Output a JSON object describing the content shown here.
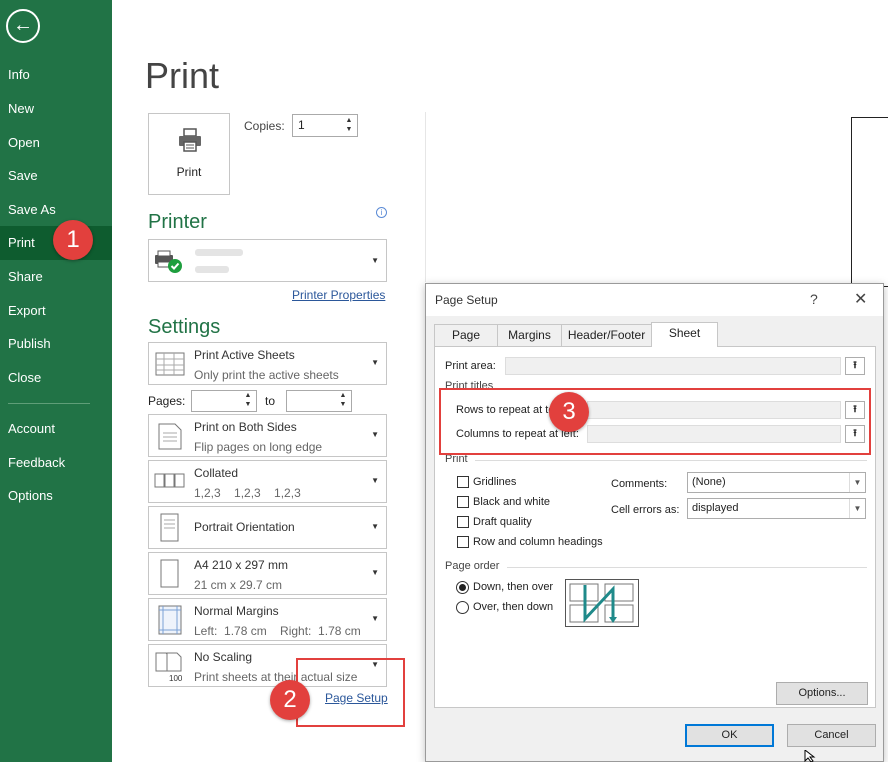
{
  "sidebar": {
    "back": "←",
    "items": [
      {
        "label": "Info"
      },
      {
        "label": "New"
      },
      {
        "label": "Open"
      },
      {
        "label": "Save"
      },
      {
        "label": "Save As"
      },
      {
        "label": "Print"
      },
      {
        "label": "Share"
      },
      {
        "label": "Export"
      },
      {
        "label": "Publish"
      },
      {
        "label": "Close"
      },
      {
        "label": "Account"
      },
      {
        "label": "Feedback"
      },
      {
        "label": "Options"
      }
    ],
    "active": "Print"
  },
  "callouts": {
    "one": "1",
    "two": "2",
    "three": "3"
  },
  "print_panel": {
    "title": "Print",
    "print_button": "Print",
    "copies_label": "Copies:",
    "copies_value": "1",
    "printer_heading": "Printer",
    "printer_info": "i",
    "printer_properties": "Printer Properties",
    "settings_heading": "Settings",
    "settings": [
      {
        "title": "Print Active Sheets",
        "subtitle": "Only print the active sheets"
      },
      {
        "title": "Print on Both Sides",
        "subtitle": "Flip pages on long edge"
      },
      {
        "title": "Collated",
        "subtitle": "1,2,3    1,2,3    1,2,3"
      },
      {
        "title": "Portrait Orientation",
        "subtitle": ""
      },
      {
        "title": "A4 210 x 297 mm",
        "subtitle": "21 cm x 29.7 cm"
      },
      {
        "title": "Normal Margins",
        "subtitle": "Left:  1.78 cm    Right:  1.78 cm"
      },
      {
        "title": "No Scaling",
        "subtitle": "Print sheets at their actual size"
      }
    ],
    "pages_label": "Pages:",
    "to_label": "to",
    "page_setup_link": "Page Setup",
    "scaling_icon_text": "100"
  },
  "dialog": {
    "title": "Page Setup",
    "help": "?",
    "close": "✕",
    "tabs": [
      {
        "label": "Page"
      },
      {
        "label": "Margins"
      },
      {
        "label": "Header/Footer"
      },
      {
        "label": "Sheet"
      }
    ],
    "selected_tab": "Sheet",
    "print_area_label": "Print area:",
    "print_titles_label": "Print titles",
    "rows_label": "Rows to repeat at to",
    "columns_label": "Columns to repeat at left:",
    "print_group": "Print",
    "checkboxes": [
      {
        "label": "Gridlines",
        "checked": false
      },
      {
        "label": "Black and white",
        "checked": false
      },
      {
        "label": "Draft quality",
        "checked": false
      },
      {
        "label": "Row and column headings",
        "checked": false
      }
    ],
    "comments_label": "Comments:",
    "comments_value": "(None)",
    "cell_errors_label": "Cell errors as:",
    "cell_errors_value": "displayed",
    "page_order_label": "Page order",
    "radios": [
      {
        "label": "Down, then over",
        "selected": true
      },
      {
        "label": "Over, then down",
        "selected": false
      }
    ],
    "options_button": "Options...",
    "ok_button": "OK",
    "cancel_button": "Cancel",
    "collapse_icon": "⭱"
  },
  "colors": {
    "accent": "#217346",
    "callout": "#e2403d",
    "link": "#2b579a"
  }
}
